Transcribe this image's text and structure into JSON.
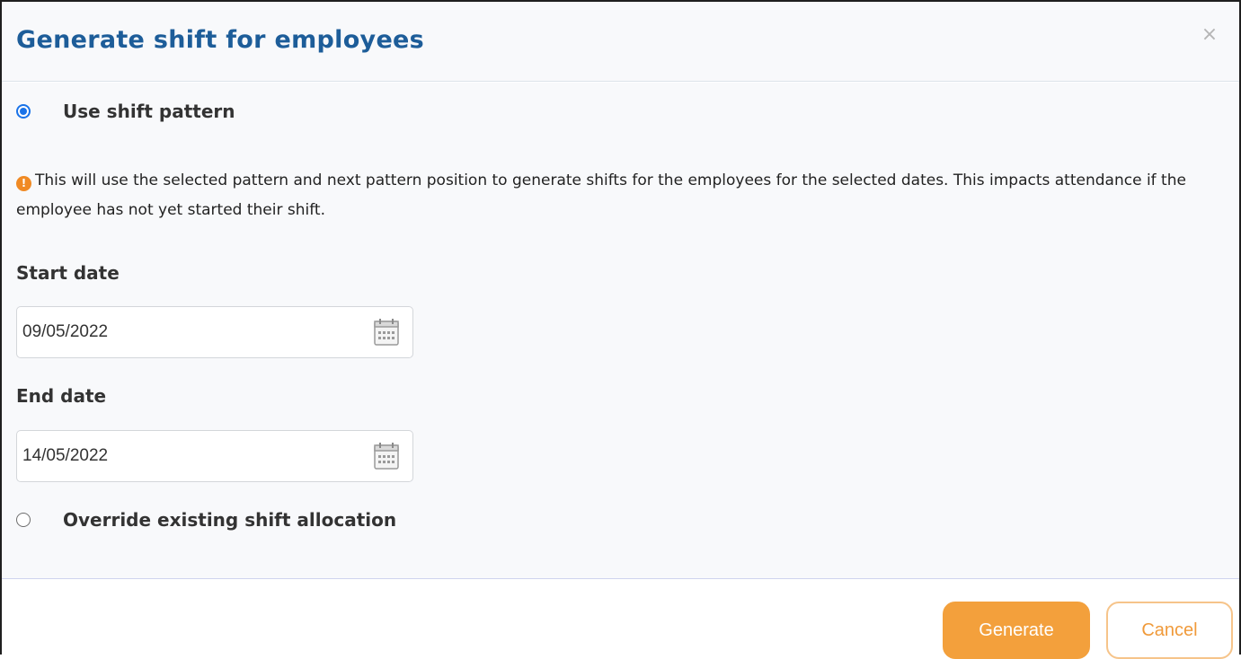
{
  "dialog": {
    "title": "Generate shift for employees",
    "close_symbol": "×"
  },
  "options": {
    "use_pattern": {
      "label": "Use shift pattern",
      "checked": true
    },
    "override": {
      "label": "Override existing shift allocation",
      "checked": false
    }
  },
  "info": {
    "icon": "alert-icon",
    "icon_symbol": "!",
    "text": "This will use the selected pattern and next pattern position to generate shifts for the employees for the selected dates. This impacts attendance if the employee has not yet started their shift."
  },
  "start_date": {
    "label": "Start date",
    "value": "09/05/2022",
    "icon": "calendar-icon"
  },
  "end_date": {
    "label": "End date",
    "value": "14/05/2022",
    "icon": "calendar-icon"
  },
  "buttons": {
    "generate": "Generate",
    "cancel": "Cancel"
  },
  "colors": {
    "title": "#1d5d99",
    "accent_orange": "#f3a03c",
    "radio_blue": "#1a73e8",
    "alert_orange": "#f08a24"
  }
}
